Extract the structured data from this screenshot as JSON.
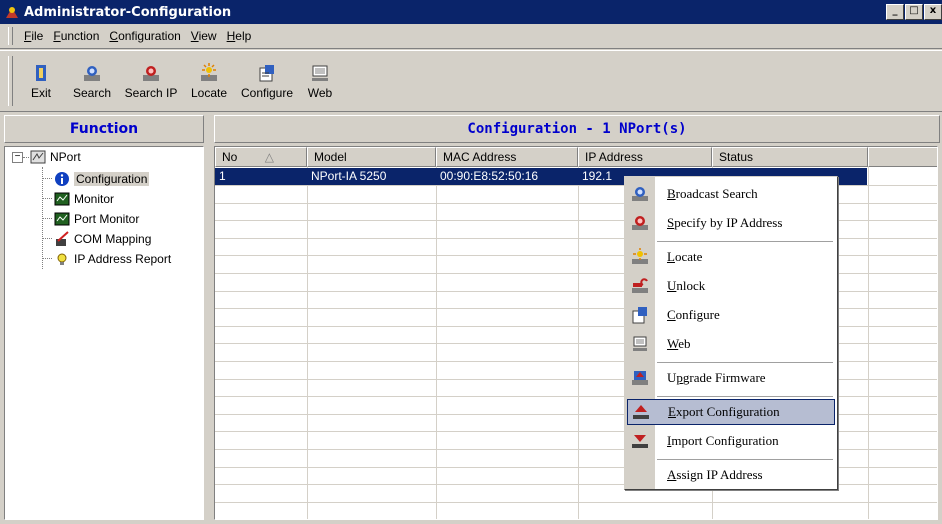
{
  "window": {
    "title": "Administrator-Configuration",
    "min": "_",
    "max": "□",
    "close": "x"
  },
  "menu": [
    {
      "key": "F",
      "rest": "ile"
    },
    {
      "key": "F",
      "rest": "unction"
    },
    {
      "key": "C",
      "rest": "onfiguration"
    },
    {
      "key": "V",
      "rest": "iew"
    },
    {
      "key": "H",
      "rest": "elp"
    }
  ],
  "toolbar": {
    "exit": "Exit",
    "search": "Search",
    "search_ip": "Search IP",
    "locate": "Locate",
    "configure": "Configure",
    "web": "Web"
  },
  "left_panel": {
    "title": "Function"
  },
  "tree": {
    "root": "NPort",
    "expander": "−",
    "items": [
      "Configuration",
      "Monitor",
      "Port Monitor",
      "COM Mapping",
      "IP Address Report"
    ]
  },
  "right_panel": {
    "title": "Configuration - 1 NPort(s)"
  },
  "table": {
    "columns": [
      "No",
      "Model",
      "MAC Address",
      "IP Address",
      "Status"
    ],
    "sort_indicator": "△",
    "rows": [
      {
        "no": "1",
        "model": "NPort-IA 5250",
        "mac": "00:90:E8:52:50:16",
        "ip": "192.1",
        "status": ""
      }
    ]
  },
  "context_menu": {
    "items": [
      {
        "key": "B",
        "rest": "roadcast Search",
        "icon": "broadcast-search-icon"
      },
      {
        "key": "S",
        "rest": "pecify by IP Address",
        "icon": "specify-ip-icon"
      },
      {
        "key": "L",
        "rest": "ocate",
        "icon": "locate-icon"
      },
      {
        "key": "U",
        "rest": "nlock",
        "icon": "unlock-icon"
      },
      {
        "key": "C",
        "rest": "onfigure",
        "icon": "configure-icon"
      },
      {
        "key": "W",
        "rest": "eb",
        "icon": "web-icon"
      },
      {
        "pre": "U",
        "key": "p",
        "rest": "grade Firmware",
        "icon": "upgrade-firmware-icon"
      },
      {
        "key": "E",
        "rest": "xport Configuration",
        "icon": "export-configuration-icon",
        "highlighted": true
      },
      {
        "key": "I",
        "rest": "mport Configuration",
        "icon": "import-configuration-icon"
      },
      {
        "key": "A",
        "rest": "ssign IP Address",
        "icon": "assign-ip-icon"
      }
    ]
  },
  "colors": {
    "title_bar": "#0a246a",
    "selection": "#0a246a",
    "panel_title": "#0000cc",
    "face": "#d4d0c8",
    "menu_highlight": "#b6bdd2"
  }
}
